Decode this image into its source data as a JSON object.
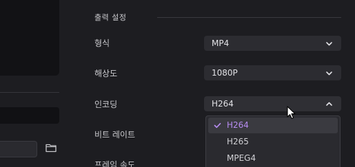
{
  "output_settings": {
    "title": "출력 설정",
    "rows": [
      {
        "label": "형식",
        "value": "MP4"
      },
      {
        "label": "해상도",
        "value": "1080P"
      },
      {
        "label": "인코딩",
        "value": "H264"
      },
      {
        "label": "비트 레이트",
        "value": ""
      },
      {
        "label": "프레임 속도",
        "value": ""
      }
    ]
  },
  "encoding_dropdown": {
    "options": [
      "H264",
      "H265",
      "MPEG4"
    ],
    "selected": "H264"
  },
  "icons": {
    "chevron_down": "chevron-down-icon",
    "chevron_up": "chevron-up-icon",
    "folder": "folder-icon",
    "check": "check-icon",
    "cursor": "mouse-cursor"
  },
  "colors": {
    "accent": "#b78cf0",
    "background": "#1d1d21",
    "field": "#2c2c31"
  }
}
